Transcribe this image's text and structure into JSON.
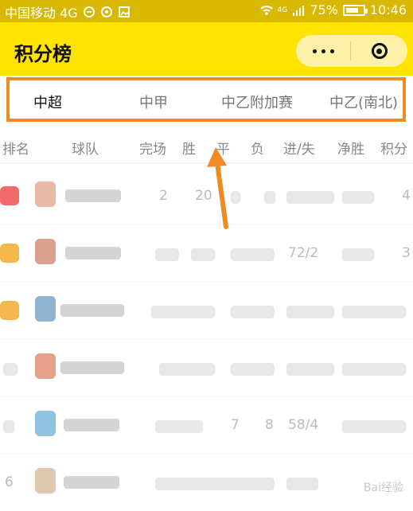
{
  "status_bar": {
    "carrier": "中国移动 4G",
    "battery": "75%",
    "battery_level": 0.75,
    "time": "10:46",
    "network_badge": "4G"
  },
  "nav": {
    "title": "积分榜",
    "more_icon": "more-dots-icon",
    "target_icon": "target-icon"
  },
  "tabs": [
    "中超",
    "中甲",
    "中乙附加赛",
    "中乙(南北)"
  ],
  "active_tab": 0,
  "table": {
    "headers": [
      "排名",
      "球队",
      "完场",
      "胜",
      "平",
      "负",
      "进/失",
      "净胜",
      "积分"
    ],
    "rows": [
      {
        "rank": "",
        "matches": "2",
        "wins": "20",
        "draws": "",
        "losses": "",
        "goals": "",
        "diff": "",
        "points": "4"
      },
      {
        "rank": "",
        "matches": "",
        "wins": "",
        "draws": "",
        "losses": "",
        "goals": "72/2",
        "diff": "",
        "points": "3"
      },
      {
        "rank": "",
        "matches": "",
        "wins": "",
        "draws": "",
        "losses": "",
        "goals": "",
        "diff": "",
        "points": ""
      },
      {
        "rank": "",
        "matches": "",
        "wins": "",
        "draws": "",
        "losses": "",
        "goals": "",
        "diff": "",
        "points": ""
      },
      {
        "rank": "",
        "matches": "",
        "wins": "7",
        "draws": "8",
        "losses": "",
        "goals": "58/4",
        "diff": "",
        "points": ""
      },
      {
        "rank": "6",
        "matches": "",
        "wins": "",
        "draws": "",
        "losses": "",
        "goals": "",
        "diff": "",
        "points": ""
      }
    ]
  },
  "annotation": {
    "highlight_color": "#f08a23"
  },
  "watermark": "Bai经验"
}
